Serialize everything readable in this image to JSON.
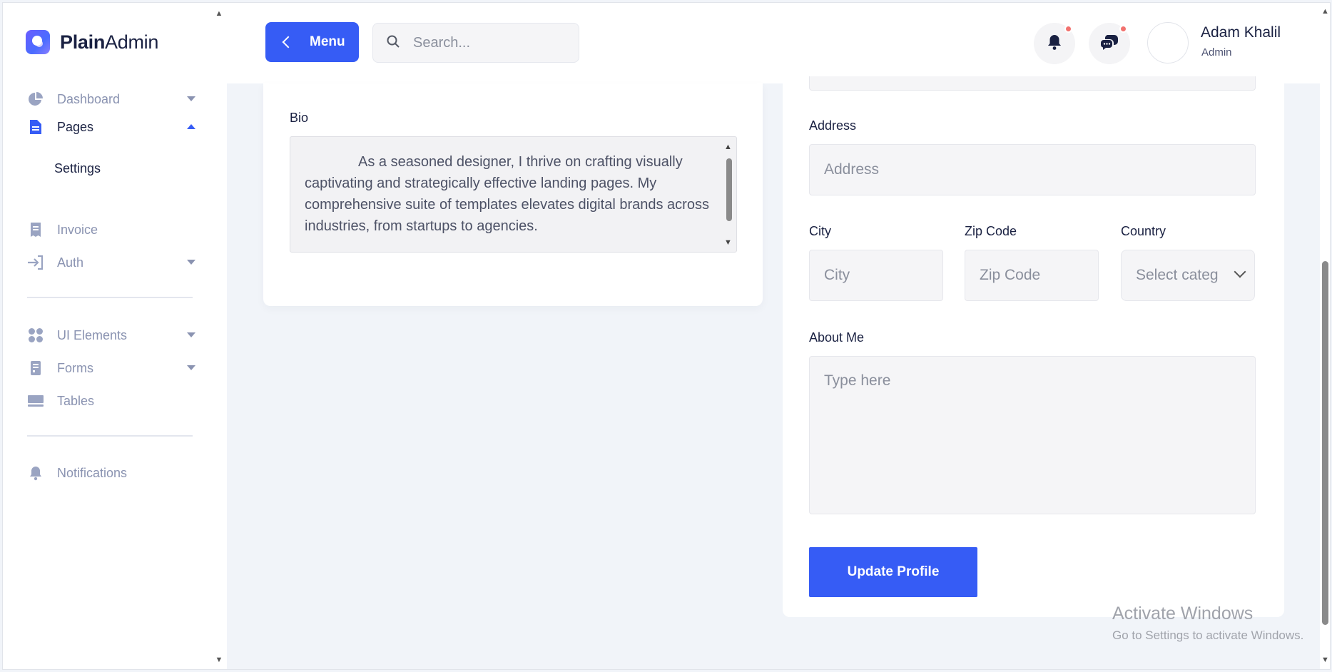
{
  "brand": {
    "name_bold": "Plain",
    "name_light": "Admin"
  },
  "sidebar": {
    "items": [
      {
        "label": "Dashboard",
        "icon": "pie-chart-icon"
      },
      {
        "label": "Pages",
        "icon": "document-icon"
      },
      {
        "label": "Settings"
      },
      {
        "label": "Invoice",
        "icon": "receipt-icon"
      },
      {
        "label": "Auth",
        "icon": "login-arrow-icon"
      },
      {
        "label": "UI Elements",
        "icon": "grid-circles-icon"
      },
      {
        "label": "Forms",
        "icon": "form-icon"
      },
      {
        "label": "Tables",
        "icon": "table-icon"
      },
      {
        "label": "Notifications",
        "icon": "bell-icon"
      }
    ]
  },
  "header": {
    "menu_label": "Menu",
    "search_placeholder": "Search...",
    "user": {
      "name": "Adam Khalil",
      "role": "Admin"
    }
  },
  "profile_card": {
    "bio_label": "Bio",
    "bio_text": "As a seasoned designer, I thrive on crafting visually captivating and strategically effective landing pages. My comprehensive suite of templates elevates digital brands across industries, from startups to agencies."
  },
  "form": {
    "address_label": "Address",
    "address_placeholder": "Address",
    "city_label": "City",
    "city_placeholder": "City",
    "zip_label": "Zip Code",
    "zip_placeholder": "Zip Code",
    "country_label": "Country",
    "country_value": "Select categ",
    "about_label": "About Me",
    "about_placeholder": "Type here",
    "submit_label": "Update Profile"
  },
  "watermark": {
    "title": "Activate Windows",
    "subtitle": "Go to Settings to activate Windows."
  },
  "colors": {
    "primary": "#365cf5",
    "dark": "#1a2142",
    "muted": "#8a93b1",
    "notification_dot": "#f2716e"
  }
}
